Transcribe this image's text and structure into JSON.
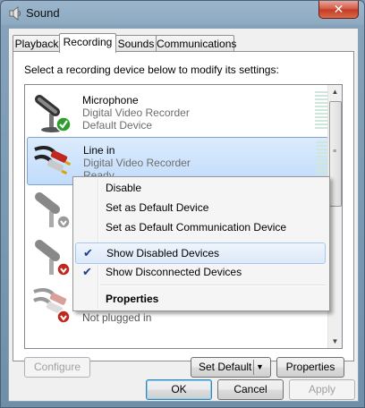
{
  "window": {
    "title": "Sound",
    "close_label": "✕"
  },
  "tabs": [
    {
      "label": "Playback"
    },
    {
      "label": "Recording"
    },
    {
      "label": "Sounds"
    },
    {
      "label": "Communications"
    }
  ],
  "instruction": "Select a recording device below to modify its settings:",
  "devices": [
    {
      "name": "Microphone",
      "line1": "Digital Video Recorder",
      "line2": "Default Device",
      "icon": "microphone-icon",
      "status": "default"
    },
    {
      "name": "Line in",
      "line1": "Digital Video Recorder",
      "line2": "Ready",
      "icon": "line-in-cable-icon",
      "status": "selected"
    },
    {
      "name": "",
      "line1": "",
      "line2": "",
      "icon": "microphone-icon",
      "status": "disabled"
    },
    {
      "name": "",
      "line1": "",
      "line2": "",
      "icon": "microphone-icon",
      "status": "unplugged"
    },
    {
      "name": "",
      "line1": "",
      "line2": "Not plugged in",
      "icon": "line-in-cable-icon",
      "status": "unplugged"
    }
  ],
  "context_menu": {
    "items": [
      {
        "label": "Disable",
        "checked": false
      },
      {
        "label": "Set as Default Device",
        "checked": false
      },
      {
        "label": "Set as Default Communication Device",
        "checked": false
      },
      {
        "label": "Show Disabled Devices",
        "checked": true
      },
      {
        "label": "Show Disconnected Devices",
        "checked": true
      },
      {
        "label": "Properties",
        "checked": false,
        "bold": true
      }
    ],
    "check_glyph": "✔"
  },
  "panel_buttons": {
    "configure": "Configure",
    "set_default": "Set Default",
    "properties": "Properties"
  },
  "dialog_buttons": {
    "ok": "OK",
    "cancel": "Cancel",
    "apply": "Apply"
  },
  "colors": {
    "accent_green": "#2e9d2e",
    "status_red": "#c0281e",
    "selection": "#c1dcfc"
  }
}
